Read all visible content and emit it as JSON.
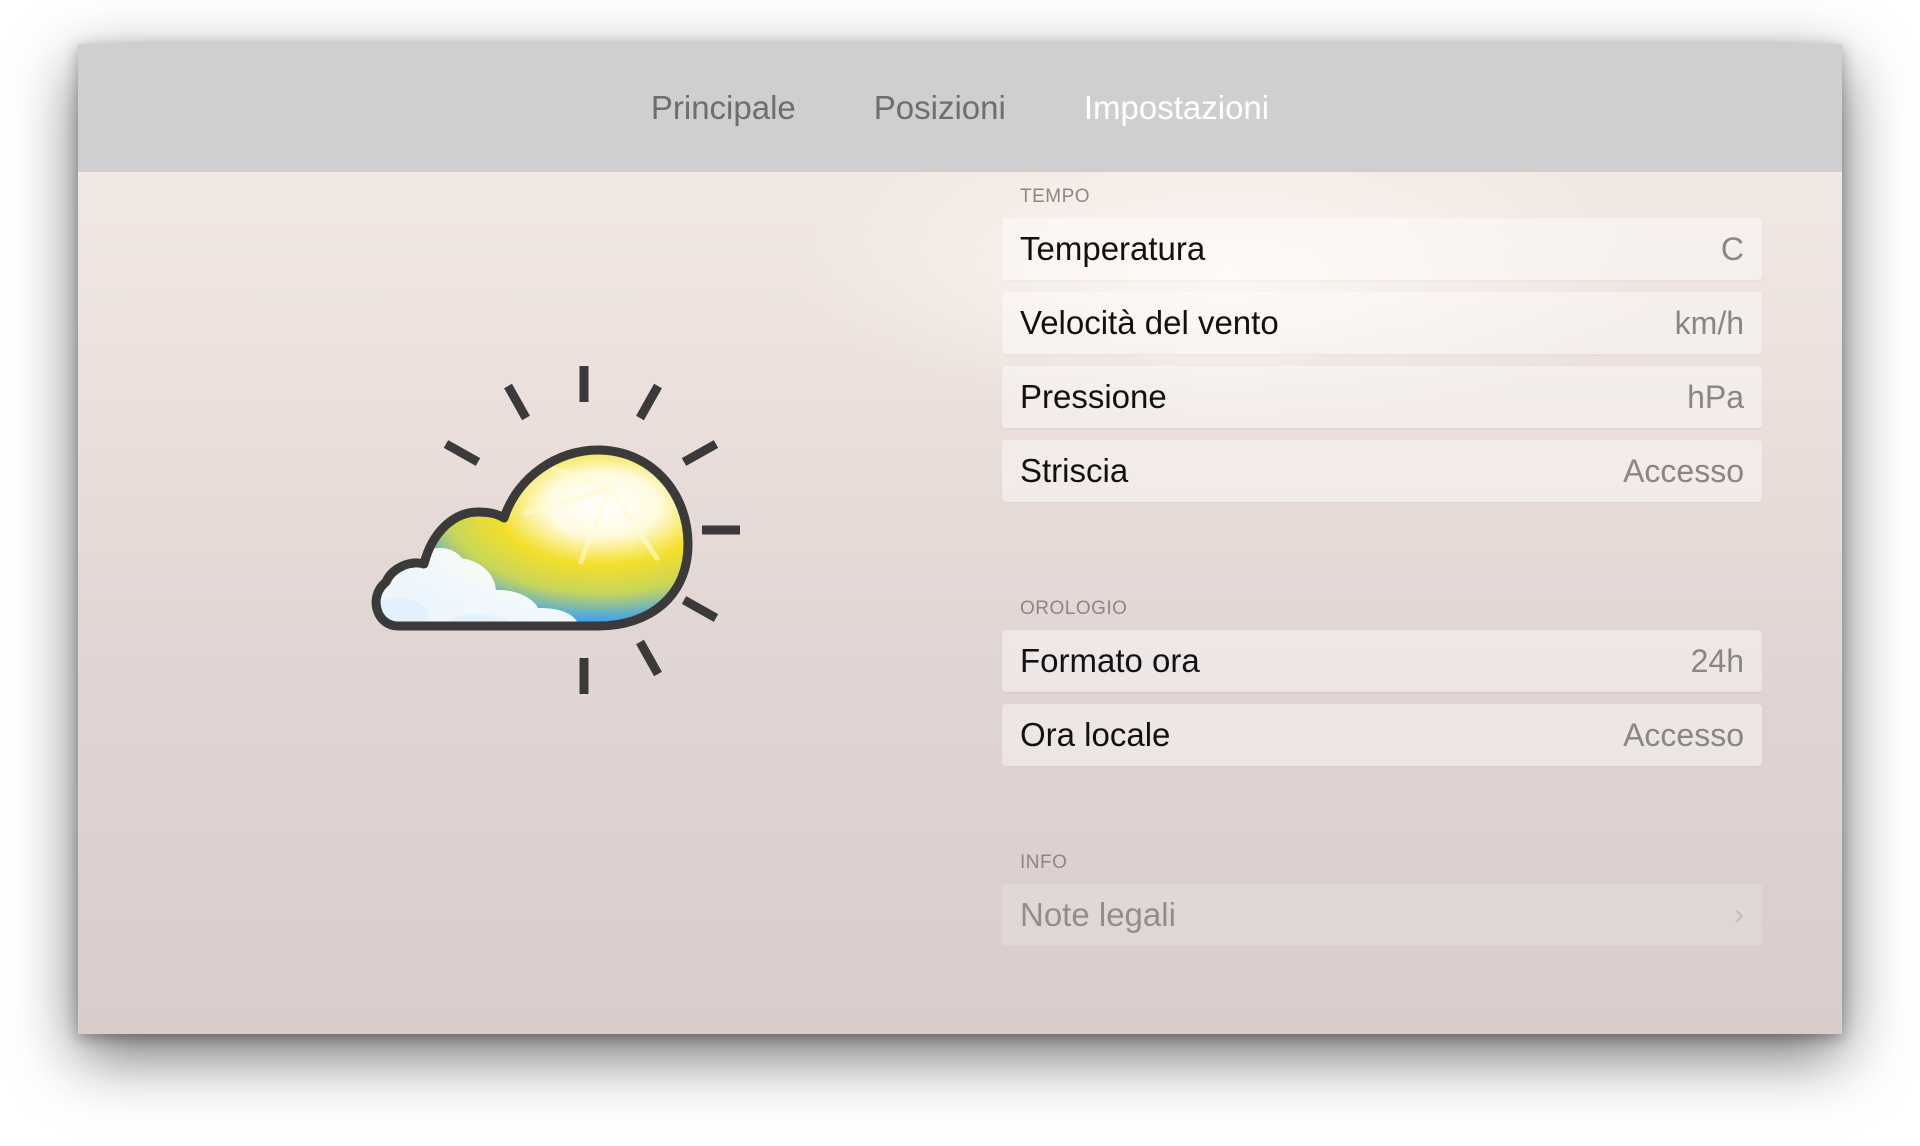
{
  "tabs": [
    {
      "label": "Principale",
      "active": false
    },
    {
      "label": "Posizioni",
      "active": false
    },
    {
      "label": "Impostazioni",
      "active": true
    }
  ],
  "icon": "partly-sunny-weather-icon",
  "sections": [
    {
      "header": "TEMPO",
      "rows": [
        {
          "label": "Temperatura",
          "value": "C"
        },
        {
          "label": "Velocità del vento",
          "value": "km/h"
        },
        {
          "label": "Pressione",
          "value": "hPa"
        },
        {
          "label": "Striscia",
          "value": "Accesso"
        }
      ]
    },
    {
      "header": "OROLOGIO",
      "rows": [
        {
          "label": "Formato ora",
          "value": "24h"
        },
        {
          "label": "Ora locale",
          "value": "Accesso"
        }
      ]
    },
    {
      "header": "INFO",
      "rows": [
        {
          "label": "Note legali",
          "value": ""
        }
      ]
    }
  ],
  "colors": {
    "tabbar": "#cfcfcf",
    "tab_inactive": "#6e6e6e",
    "tab_active": "#ffffff",
    "sky_blue": "#2a8fe8",
    "sun_yellow": "#f2dc2a"
  }
}
